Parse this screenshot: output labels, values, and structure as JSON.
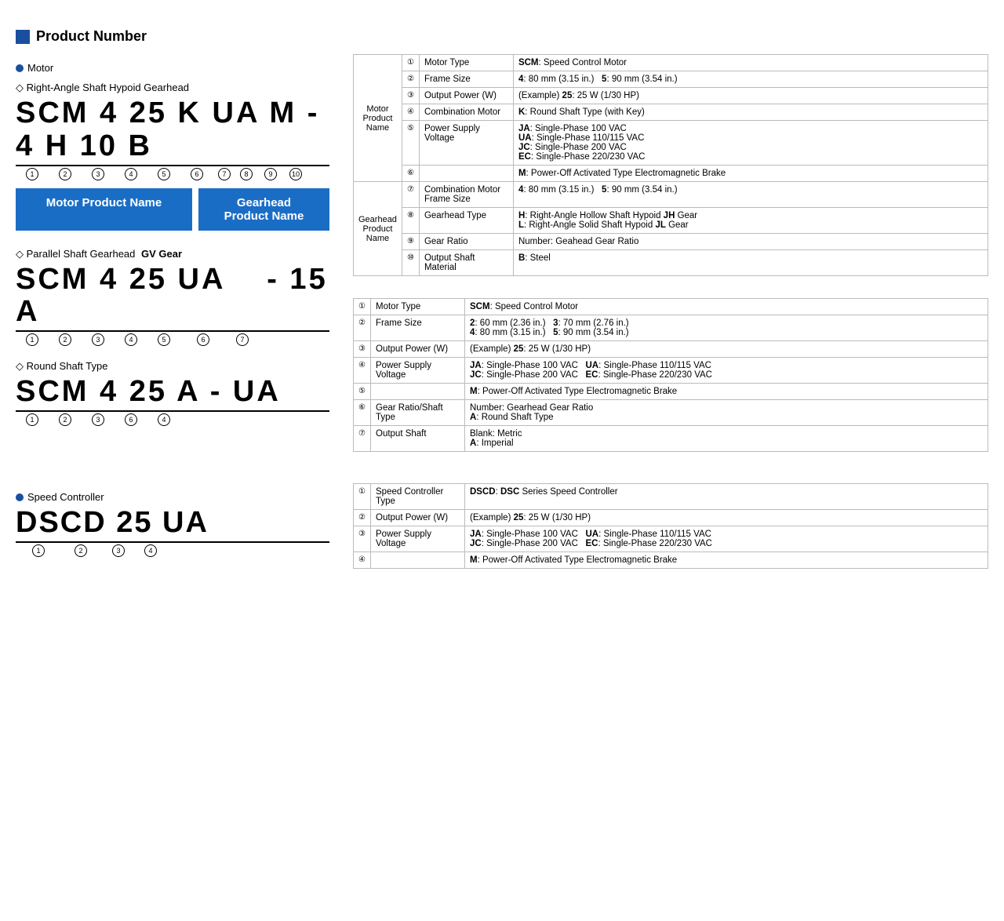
{
  "page": {
    "section_title": "Product Number",
    "motor_label": "Motor",
    "gearhead_right_label": "Right-Angle Shaft Hypoid Gearhead",
    "gearhead_parallel_label": "Parallel Shaft Gearhead",
    "gearhead_parallel_extra": "GV Gear",
    "gearhead_round_label": "Round Shaft Type",
    "sc_label": "Speed Controller",
    "motor_product_name": "Motor Product Name",
    "gearhead_product_name": "Gearhead\nProduct Name",
    "product_code_right": "SCM 4 25 K UA M - 4 H 10 B",
    "product_code_parallel": "SCM 4 25 UA    - 15 A",
    "product_code_round": "SCM 4 25 A - UA",
    "product_code_sc": "DSCD 25 UA",
    "right_circles": [
      "①",
      "②",
      "③",
      "④",
      "⑤",
      "⑥",
      "⑦",
      "⑧",
      "⑨",
      "⑩"
    ],
    "parallel_circles": [
      "①",
      "②",
      "③",
      "④",
      "⑤",
      "⑥",
      "⑦"
    ],
    "round_circles": [
      "①",
      "②",
      "③",
      "⑥",
      "④"
    ],
    "sc_circles": [
      "①",
      "②",
      "③",
      "④"
    ],
    "table_right": {
      "group_motor": "Motor\nProduct\nName",
      "group_gearhead": "Gearhead\nProduct\nName",
      "rows": [
        {
          "num": "①",
          "label": "Motor Type",
          "value": "<b>SCM</b>: Speed Control Motor"
        },
        {
          "num": "②",
          "label": "Frame Size",
          "value": "<b>4</b>: 80 mm (3.15 in.)   <b>5</b>: 90 mm (3.54 in.)"
        },
        {
          "num": "③",
          "label": "Output Power (W)",
          "value": "(Example) <b>25</b>: 25 W (1/30 HP)"
        },
        {
          "num": "④",
          "label": "Combination Motor",
          "value": "<b>K</b>: Round Shaft Type (with Key)"
        },
        {
          "num": "⑤",
          "label": "Power Supply Voltage",
          "value": "<b>JA</b>: Single-Phase 100 VAC\n<b>UA</b>: Single-Phase 110/115 VAC\n<b>JC</b>: Single-Phase 200 VAC\n<b>EC</b>: Single-Phase 220/230 VAC"
        },
        {
          "num": "⑥",
          "label": "",
          "value": "<b>M</b>: Power-Off Activated Type Electromagnetic Brake"
        },
        {
          "num": "⑦",
          "label": "Combination Motor\nFrame Size",
          "value": "<b>4</b>: 80 mm (3.15 in.)   <b>5</b>: 90 mm (3.54 in.)"
        },
        {
          "num": "⑧",
          "label": "Gearhead Type",
          "value": "<b>H</b>: Right-Angle Hollow Shaft Hypoid <b>JH</b> Gear\n<b>L</b>: Right-Angle Solid Shaft Hypoid <b>JL</b> Gear"
        },
        {
          "num": "⑨",
          "label": "Gear Ratio",
          "value": "Number: Geahead Gear Ratio"
        },
        {
          "num": "⑩",
          "label": "Output Shaft Material",
          "value": "<b>B</b>: Steel"
        }
      ]
    },
    "table_parallel": {
      "rows": [
        {
          "num": "①",
          "label": "Motor Type",
          "value": "<b>SCM</b>: Speed Control Motor"
        },
        {
          "num": "②",
          "label": "Frame Size",
          "value": "<b>2</b>: 60 mm (2.36 in.)   <b>3</b>: 70 mm (2.76 in.)\n<b>4</b>: 80 mm (3.15 in.)   <b>5</b>: 90 mm (3.54 in.)"
        },
        {
          "num": "③",
          "label": "Output Power (W)",
          "value": "(Example) <b>25</b>: 25 W (1/30 HP)"
        },
        {
          "num": "④",
          "label": "Power Supply Voltage",
          "value": "<b>JA</b>: Single-Phase 100 VAC   <b>UA</b>: Single-Phase 110/115 VAC\n<b>JC</b>: Single-Phase 200 VAC   <b>EC</b>: Single-Phase 220/230 VAC"
        },
        {
          "num": "⑤",
          "label": "",
          "value": "<b>M</b>: Power-Off Activated Type Electromagnetic Brake"
        },
        {
          "num": "⑥",
          "label": "Gear Ratio/Shaft\nType",
          "value": "Number: Gearhead Gear Ratio\n<b>A</b>: Round Shaft Type"
        },
        {
          "num": "⑦",
          "label": "Output Shaft",
          "value": "Blank: Metric\n<b>A</b>: Imperial"
        }
      ]
    },
    "table_sc": {
      "rows": [
        {
          "num": "①",
          "label": "Speed Controller\nType",
          "value": "<b>DSCD</b>: <b>DSC</b> Series Speed Controller"
        },
        {
          "num": "②",
          "label": "Output Power (W)",
          "value": "(Example) <b>25</b>: 25 W (1/30 HP)"
        },
        {
          "num": "③",
          "label": "Power Supply Voltage",
          "value": "<b>JA</b>: Single-Phase 100 VAC   <b>UA</b>: Single-Phase 110/115 VAC\n<b>JC</b>: Single-Phase 200 VAC   <b>EC</b>: Single-Phase 220/230 VAC"
        },
        {
          "num": "④",
          "label": "",
          "value": "<b>M</b>: Power-Off Activated Type Electromagnetic Brake"
        }
      ]
    }
  }
}
